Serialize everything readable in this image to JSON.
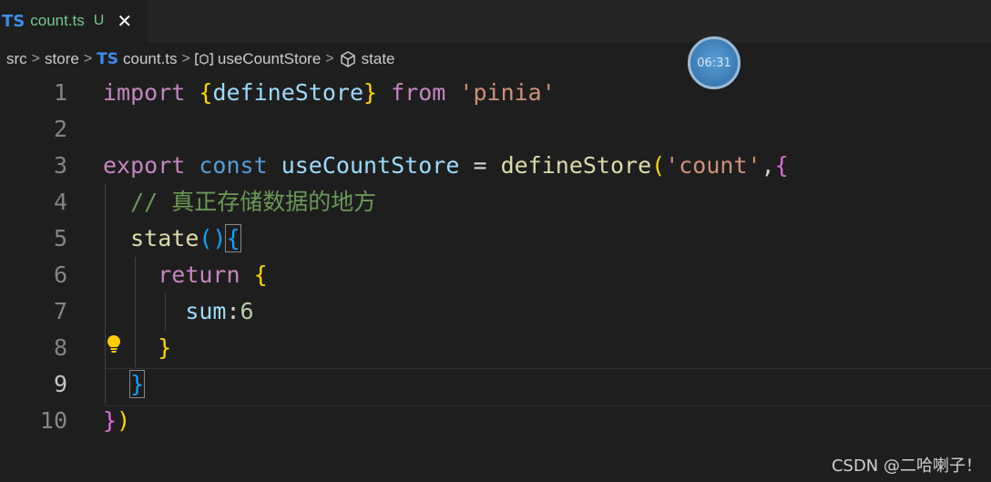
{
  "tab": {
    "badge": "TS",
    "filename": "count.ts",
    "status": "U",
    "close": "✕"
  },
  "breadcrumb": {
    "items": [
      "src",
      "store",
      "count.ts",
      "useCountStore",
      "state"
    ],
    "ts_badge": "TS",
    "sep": ">"
  },
  "line_numbers": [
    "1",
    "2",
    "3",
    "4",
    "5",
    "6",
    "7",
    "8",
    "9",
    "10"
  ],
  "active_line": "9",
  "code": {
    "l1": {
      "import": "import",
      "open": "{",
      "name": "defineStore",
      "close": "}",
      "from": "from",
      "str": "'pinia'"
    },
    "l3": {
      "export": "export",
      "const": "const",
      "name": "useCountStore",
      "eq": "=",
      "fn": "defineStore",
      "open_paren": "(",
      "str": "'count'",
      "comma": ",",
      "open_brace": "{"
    },
    "l4": {
      "comment": "// 真正存储数据的地方"
    },
    "l5": {
      "fn": "state",
      "parens": "()",
      "open": "{"
    },
    "l6": {
      "ret": "return",
      "open": "{"
    },
    "l7": {
      "key": "sum",
      "colon": ":",
      "val": "6"
    },
    "l8": {
      "close": "}"
    },
    "l9": {
      "close": "}"
    },
    "l10": {
      "close_brace": "}",
      "close_paren": ")"
    }
  },
  "timer": "06:31",
  "watermark": "CSDN @二哈喇子！",
  "icons": [
    "close-icon",
    "symbol-variable-icon",
    "symbol-field-icon",
    "lightbulb-icon"
  ],
  "colors": {
    "keyword": "#c586c0",
    "storage": "#569cd6",
    "variable": "#9cdcfe",
    "function": "#dcdcaa",
    "string": "#ce9178",
    "number": "#b5cea8",
    "comment": "#6a9955"
  }
}
